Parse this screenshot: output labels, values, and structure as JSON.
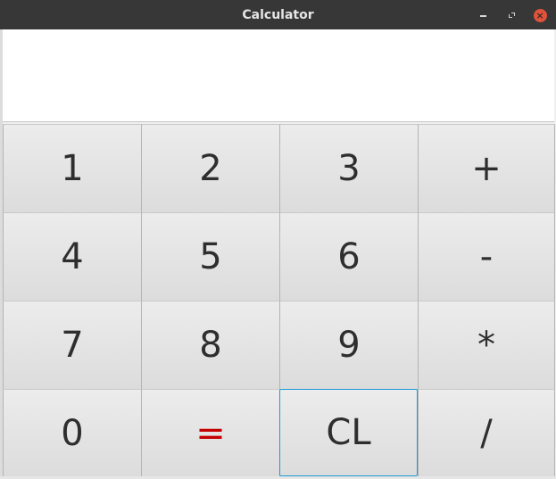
{
  "window": {
    "title": "Calculator",
    "controls": {
      "minimize": "minimize",
      "restore": "restore",
      "close": "×"
    }
  },
  "display": {
    "value": ""
  },
  "keys": [
    {
      "label": "1"
    },
    {
      "label": "2"
    },
    {
      "label": "3"
    },
    {
      "label": "+"
    },
    {
      "label": "4"
    },
    {
      "label": "5"
    },
    {
      "label": "6"
    },
    {
      "label": "-"
    },
    {
      "label": "7"
    },
    {
      "label": "8"
    },
    {
      "label": "9"
    },
    {
      "label": "*"
    },
    {
      "label": "0"
    },
    {
      "label": "="
    },
    {
      "label": "CL"
    },
    {
      "label": "/"
    }
  ],
  "colors": {
    "titlebar": "#373737",
    "equals_key_text": "#c40000",
    "focus_ring": "#1e9ad6",
    "close_button": "#e0533b"
  },
  "focused_key": "CL"
}
